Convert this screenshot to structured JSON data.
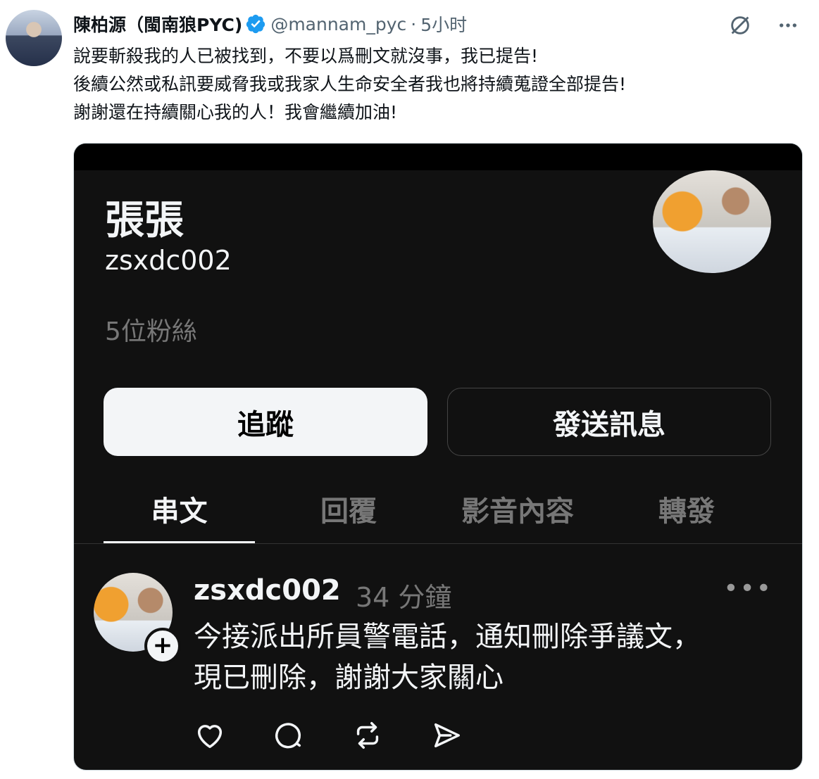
{
  "author": {
    "display_name": "陳柏源（閩南狼PYC)",
    "handle": "@mannam_pyc",
    "separator": "·",
    "time": "5小时"
  },
  "tweet_lines": [
    "說要斬殺我的人已被找到，不要以爲刪文就沒事，我已提告!",
    "後續公然或私訊要威脅我或我家人生命安全者我也將持續蒐證全部提告!",
    "謝謝還在持續關心我的人！我會繼續加油!"
  ],
  "card": {
    "name": "張張",
    "handle": "zsxdc002",
    "followers": "5位粉絲",
    "follow_button": "追蹤",
    "message_button": "發送訊息",
    "tabs": [
      {
        "label": "串文",
        "active": true
      },
      {
        "label": "回覆",
        "active": false
      },
      {
        "label": "影音內容",
        "active": false
      },
      {
        "label": "轉發",
        "active": false
      }
    ],
    "post": {
      "user": "zsxdc002",
      "time": "34 分鐘",
      "more": "•••",
      "line1": "今接派出所員警電話，通知刪除爭議文，",
      "line2": "現已刪除，謝謝大家關心"
    }
  },
  "icons": [
    "verified-badge-icon",
    "grok-icon",
    "more-icon",
    "heart-icon",
    "comment-icon",
    "repost-icon",
    "share-icon",
    "plus-icon"
  ],
  "colors": {
    "verified": "#1d9bf0",
    "card_bg": "#111111",
    "muted": "#536471"
  }
}
